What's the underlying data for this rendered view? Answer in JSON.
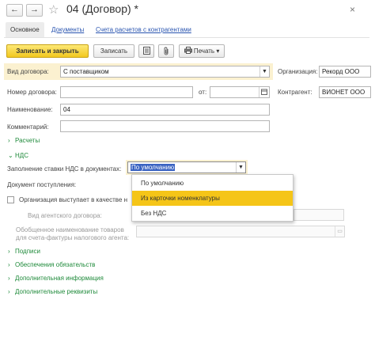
{
  "window": {
    "title": "04 (Договор) *",
    "back_icon": "←",
    "forward_icon": "→",
    "star_icon": "☆",
    "close_icon": "×"
  },
  "tabs": [
    {
      "label": "Основное",
      "active": true
    },
    {
      "label": "Документы",
      "active": false
    },
    {
      "label": "Счета расчетов с контрагентами",
      "active": false
    }
  ],
  "toolbar": {
    "save_close_label": "Записать и закрыть",
    "save_label": "Записать",
    "print_label": "Печать",
    "print_arrow": "▾"
  },
  "form": {
    "contract_type_label": "Вид договора:",
    "contract_type_value": "С поставщиком",
    "organization_label": "Организация:",
    "organization_value": "Рекорд ООО",
    "number_label": "Номер договора:",
    "number_value": "",
    "from_label": "от:",
    "date_value": "",
    "counterparty_label": "Контрагент:",
    "counterparty_value": "ВИОНЕТ ООО",
    "name_label": "Наименование:",
    "name_value": "04",
    "comment_label": "Комментарий:",
    "comment_value": ""
  },
  "sections": {
    "payments": "Расчеты",
    "vat": "НДС",
    "signatures": "Подписи",
    "obligations": "Обеспечения обязательств",
    "additional_info": "Дополнительная информация",
    "additional_props": "Дополнительные реквизиты"
  },
  "vat": {
    "rate_fill_label": "Заполнение ставки НДС в документах:",
    "rate_fill_value": "По умолчанию",
    "receipt_doc_label": "Документ поступления:",
    "agent_checkbox_label": "Организация выступает в качестве н",
    "agent_contract_type_label": "Вид агентского договора:",
    "generic_name_label_1": "Обобщенное наименование товаров",
    "generic_name_label_2": "для счета-фактуры налогового агента:"
  },
  "dropdown": {
    "options": [
      "По умолчанию",
      "Из карточки номенклатуры",
      "Без НДС"
    ],
    "highlighted_index": 1
  },
  "colors": {
    "accent_yellow": "#f5c518",
    "section_green": "#1e8a3a",
    "link_blue": "#2a55b0"
  }
}
